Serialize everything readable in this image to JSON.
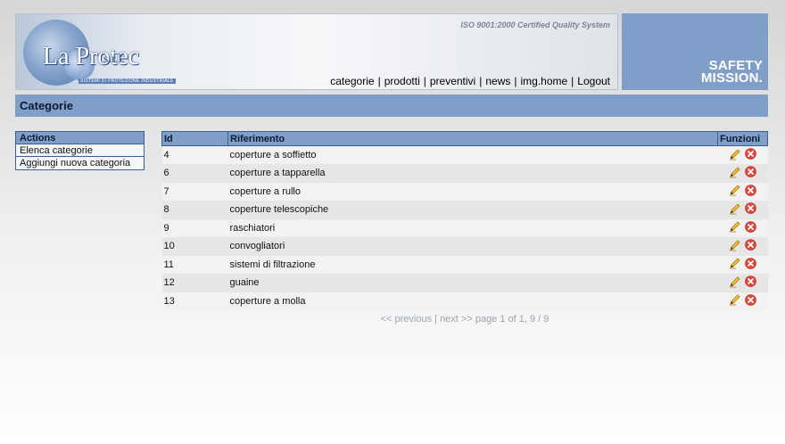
{
  "header": {
    "logo_text": "La Protec",
    "logo_suffix": "s.r.l.",
    "logo_tagline": "SISTEMI DI PROTEZIONE INDUSTRIALE",
    "iso": "ISO 9001:2000 Certified Quality System",
    "slogan_line1": "SAFETY",
    "slogan_line2": "MISSION.",
    "nav": [
      "categorie",
      "prodotti",
      "preventivi",
      "news",
      "img.home",
      "Logout"
    ]
  },
  "page_title": "Categorie",
  "sidebar": {
    "title": "Actions",
    "items": [
      "Elenca categorie",
      "Aggiungi nuova categoria"
    ]
  },
  "table": {
    "headers": [
      "Id",
      "Riferimento",
      "Funzioni"
    ],
    "rows": [
      {
        "id": "4",
        "ref": "coperture a soffietto"
      },
      {
        "id": "6",
        "ref": "coperture a tapparella"
      },
      {
        "id": "7",
        "ref": "coperture a rullo"
      },
      {
        "id": "8",
        "ref": "coperture telescopiche"
      },
      {
        "id": "9",
        "ref": "raschiatori"
      },
      {
        "id": "10",
        "ref": "convogliatori"
      },
      {
        "id": "11",
        "ref": "sistemi di filtrazione"
      },
      {
        "id": "12",
        "ref": "guaine"
      },
      {
        "id": "13",
        "ref": "coperture a molla"
      }
    ]
  },
  "pager": {
    "prev": "<< previous",
    "sep": "|",
    "next": "next >>",
    "info": "page 1 of 1, 9 / 9"
  },
  "icons": {
    "edit": "pencil-icon",
    "delete": "delete-icon"
  },
  "colors": {
    "accent": "#7f9ec8",
    "border": "#3d5f8f",
    "delete": "#e0463b"
  }
}
